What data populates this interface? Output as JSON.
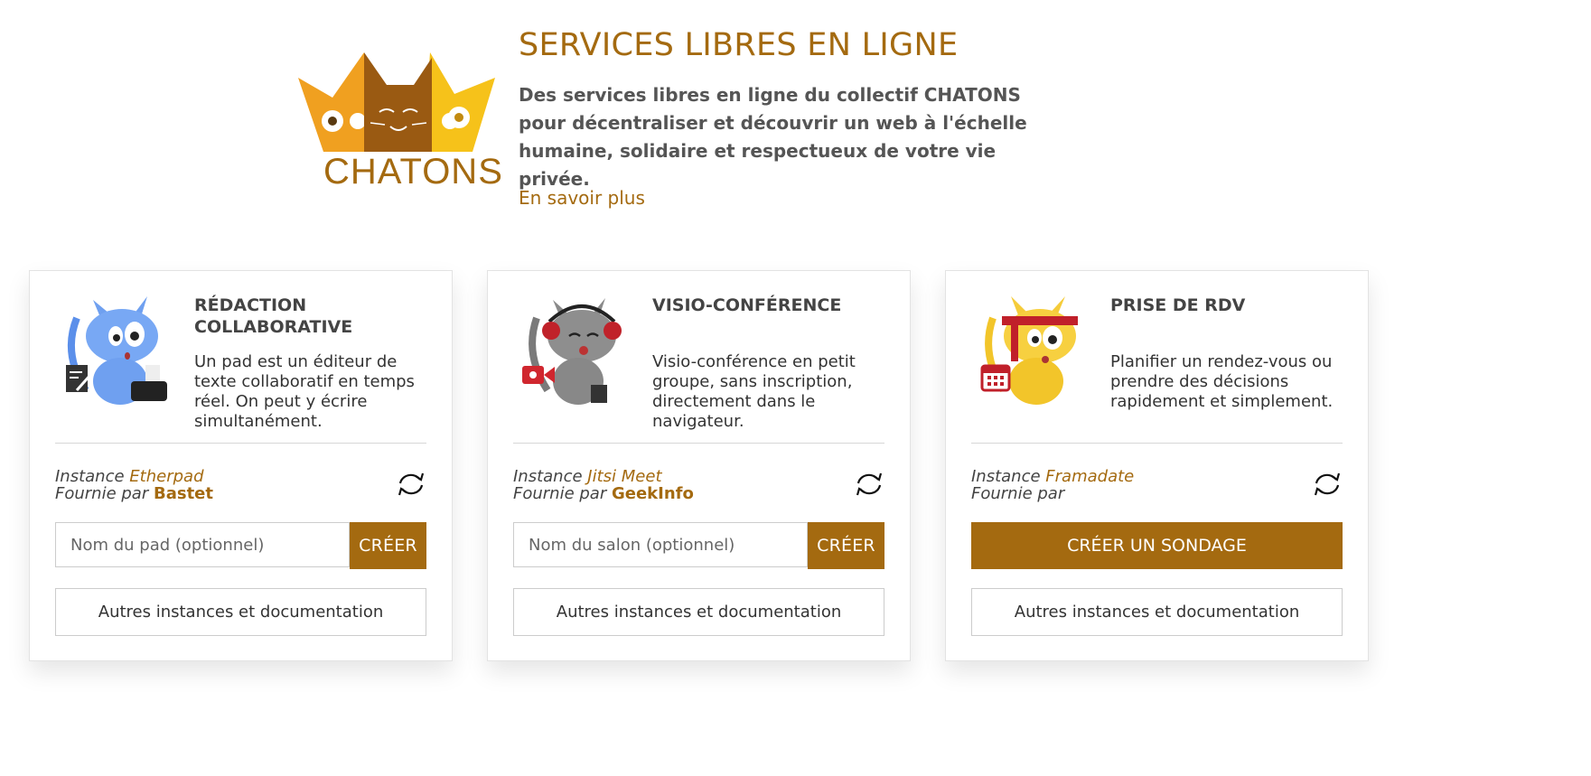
{
  "brand": {
    "logo_text": "CHATONS",
    "accent_color": "#A46A10"
  },
  "header": {
    "title": "SERVICES LIBRES EN LIGNE",
    "description": "Des services libres en ligne du collectif CHATONS pour décentraliser et découvrir un web à l'échelle humaine, solidaire et respectueux de votre vie privée.",
    "more_link": "En savoir plus"
  },
  "cards": [
    {
      "title": "RÉDACTION COLLABORATIVE",
      "description": "Un pad est un éditeur de texte collaboratif en temps réel. On peut y écrire simultanément.",
      "instance_prefix": "Instance",
      "instance_name": "Etherpad",
      "provided_prefix": "Fournie par",
      "provider": "Bastet",
      "input_placeholder": "Nom du pad (optionnel)",
      "input_value": "",
      "action_label": "CRÉER",
      "docs_label": "Autres instances et documentation",
      "icon": "pen-document-icon"
    },
    {
      "title": "VISIO-CONFÉRENCE",
      "description": "Visio-conférence en petit groupe, sans inscription, directement dans le navigateur.",
      "instance_prefix": "Instance",
      "instance_name": "Jitsi Meet",
      "provided_prefix": "Fournie par",
      "provider": "GeekInfo",
      "input_placeholder": "Nom du salon (optionnel)",
      "input_value": "",
      "action_label": "CRÉER",
      "docs_label": "Autres instances et documentation",
      "icon": "video-camera-icon"
    },
    {
      "title": "PRISE DE RDV",
      "description": "Planifier un rendez-vous ou prendre des décisions rapidement et simplement.",
      "instance_prefix": "Instance",
      "instance_name": "Framadate",
      "provided_prefix": "Fournie par",
      "provider": "",
      "action_label": "CRÉER UN SONDAGE",
      "docs_label": "Autres instances et documentation",
      "icon": "calendar-icon"
    }
  ]
}
